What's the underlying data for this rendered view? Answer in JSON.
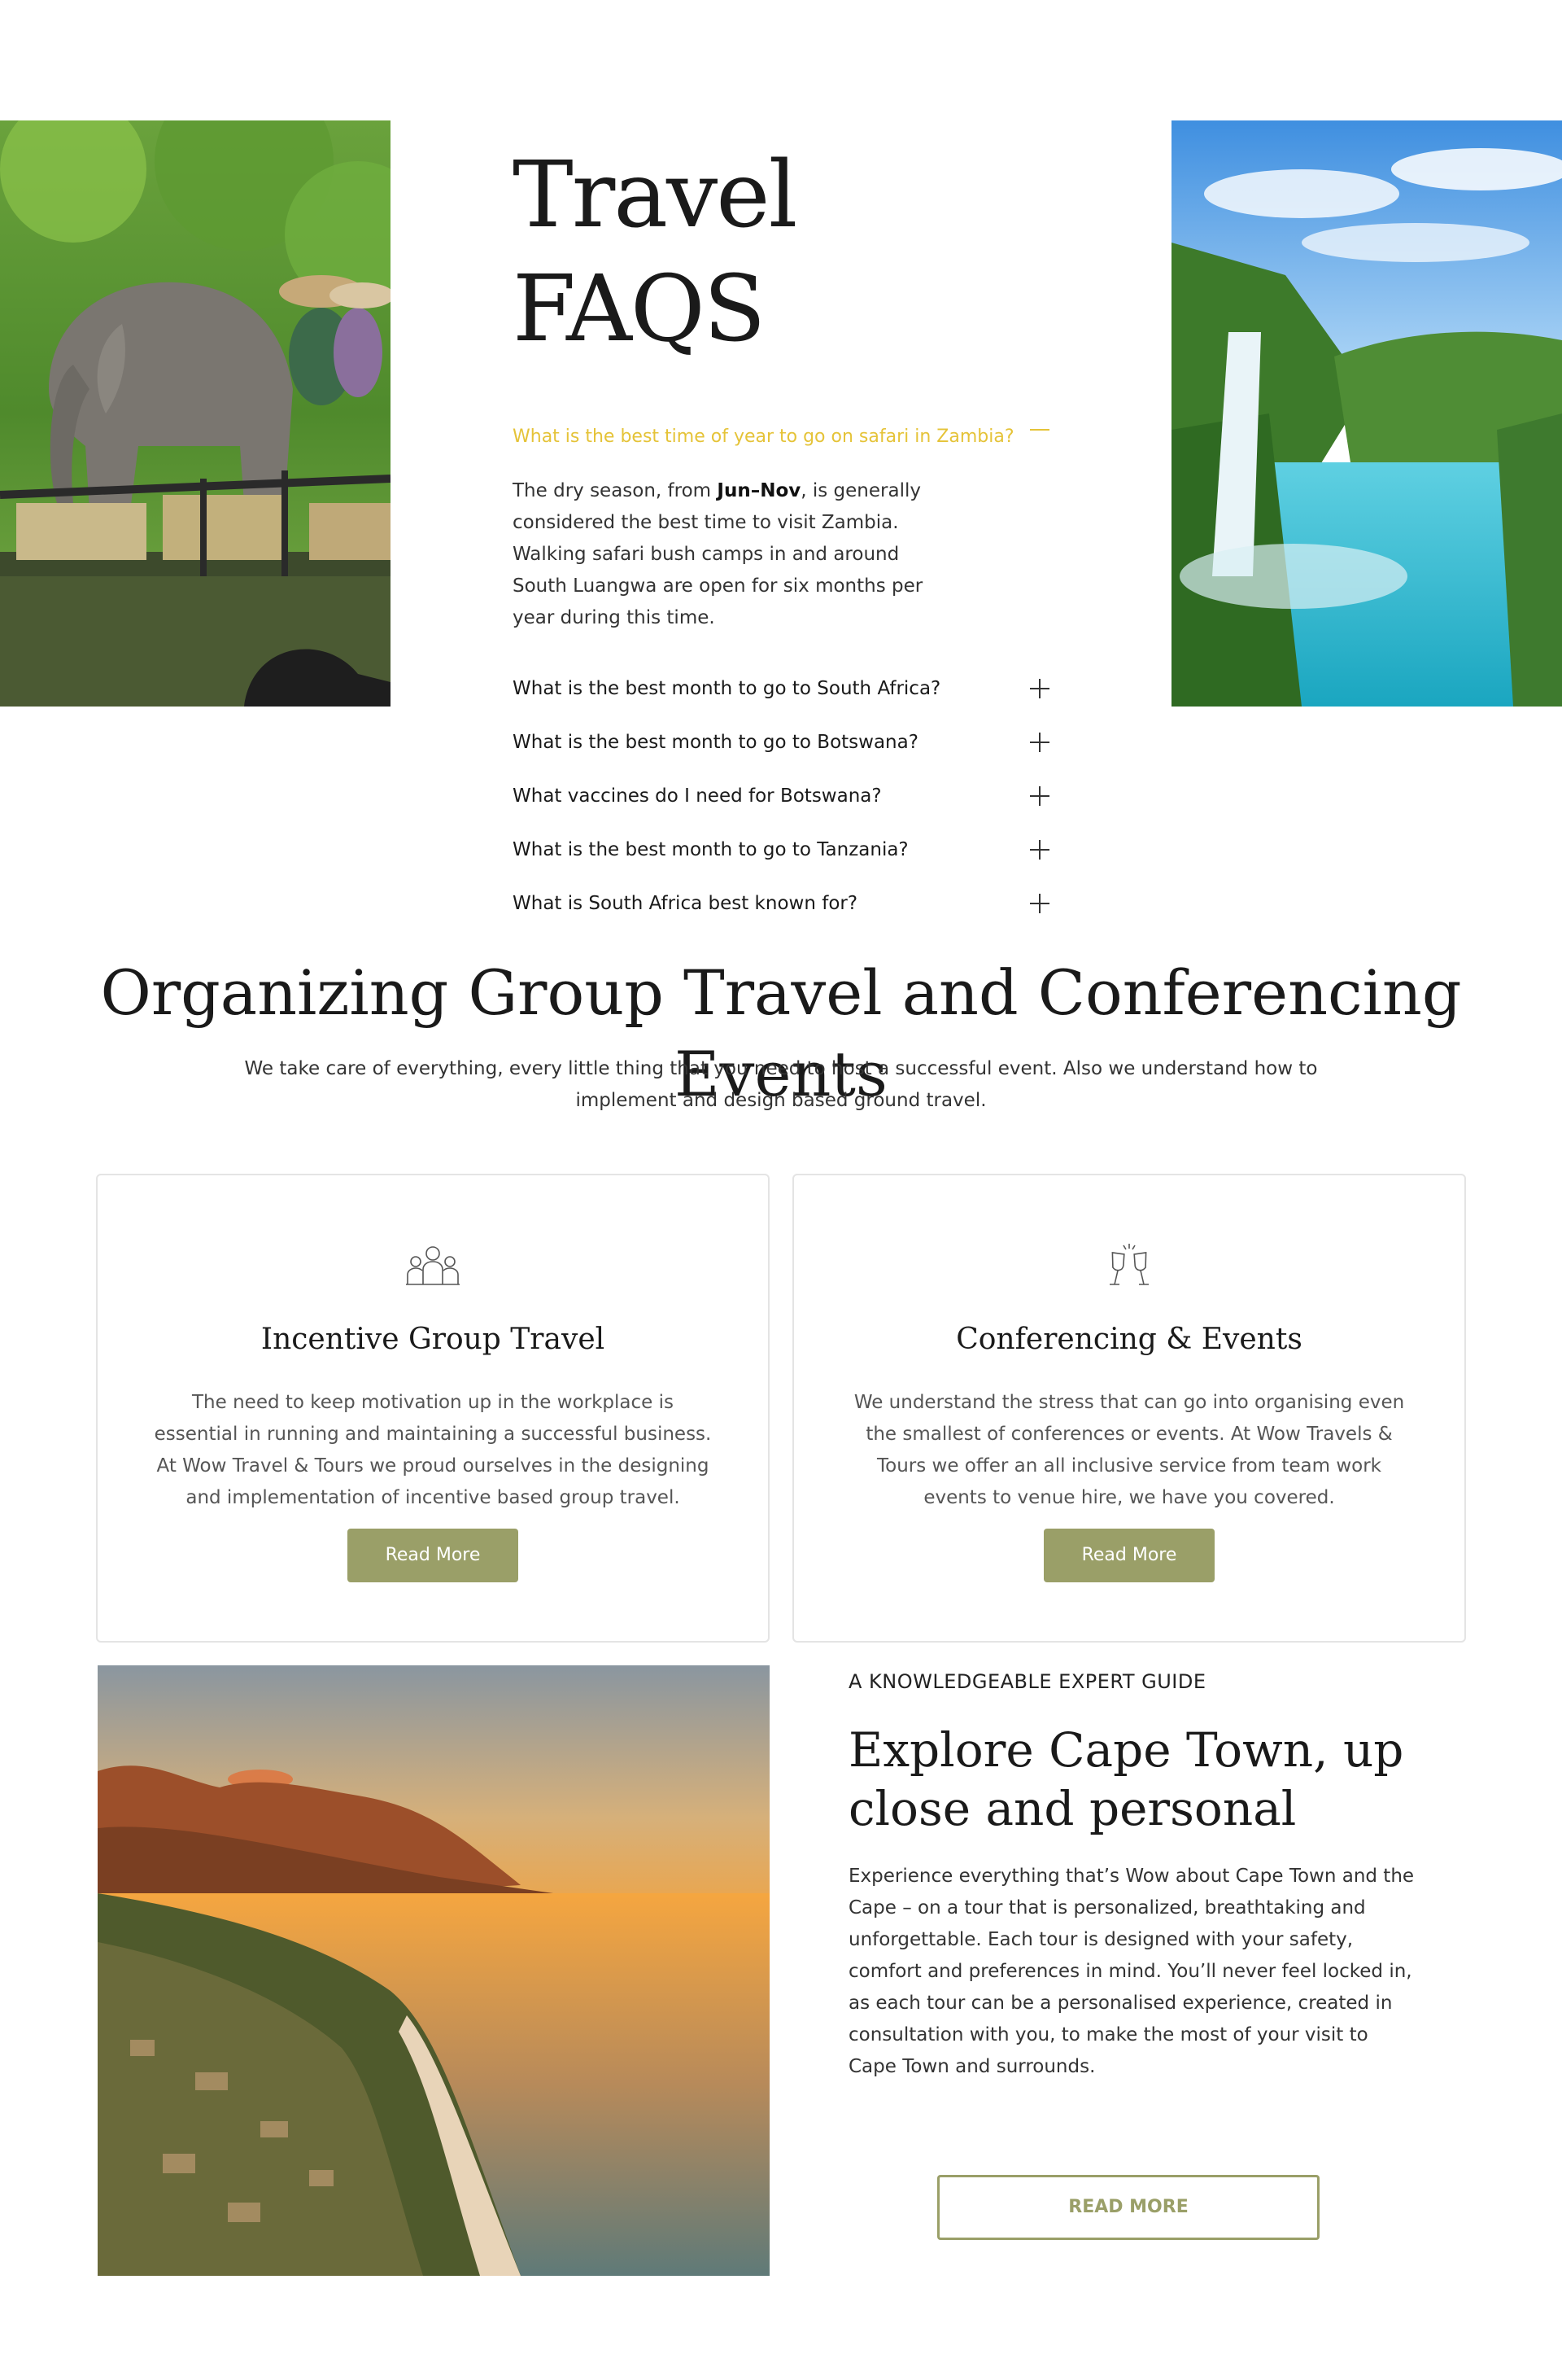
{
  "faq": {
    "title": "Travel FAQS",
    "open_question": "What is the best time of year to go on safari in Zambia?",
    "answer_before": "The dry season, from ",
    "answer_bold": "Jun–Nov",
    "answer_after": ", is generally considered the best time to visit Zambia. Walking safari bush camps in and around South Luangwa are open for six months per year during this time.",
    "items": [
      {
        "question": "What is the best month to go to South Africa?"
      },
      {
        "question": "What is the best month to go to Botswana?"
      },
      {
        "question": "What vaccines do I need for Botswana?"
      },
      {
        "question": "What is the best month to go to Tanzania?"
      },
      {
        "question": "What is South Africa best known for?"
      }
    ],
    "accent_color": "#e5c338"
  },
  "group": {
    "title": "Organizing Group Travel and Conferencing Events",
    "subtitle": "We take care of everything, every little thing that you need to host a successful event. Also we understand how to implement and design based ground travel.",
    "cards": [
      {
        "icon": "group-people-icon",
        "title": "Incentive Group Travel",
        "text": "The need to keep motivation up in the workplace is essential in running and maintaining a successful business. At Wow Travel & Tours we proud ourselves in the designing and implementation of incentive based group travel.",
        "button": "Read More"
      },
      {
        "icon": "champagne-glasses-icon",
        "title": "Conferencing & Events",
        "text": "We understand the stress that can go into organising even the smallest of conferences or events. At Wow Travels & Tours we offer an all inclusive service from team work events to venue hire, we have you covered.",
        "button": "Read More"
      }
    ],
    "button_color": "#9a9f68"
  },
  "cape": {
    "eyebrow": "A KNOWLEDGEABLE EXPERT GUIDE",
    "title": "Explore Cape Town, up close and personal",
    "text": "Experience everything that’s Wow about Cape Town and the Cape – on a tour that is personalized, breathtaking and unforgettable. Each tour is designed with your safety, comfort and preferences in mind. You’ll never feel locked in, as each tour can be a personalised experience, created in consultation with you, to make the most of your visit to Cape Town and surrounds.",
    "button": "READ MORE"
  }
}
